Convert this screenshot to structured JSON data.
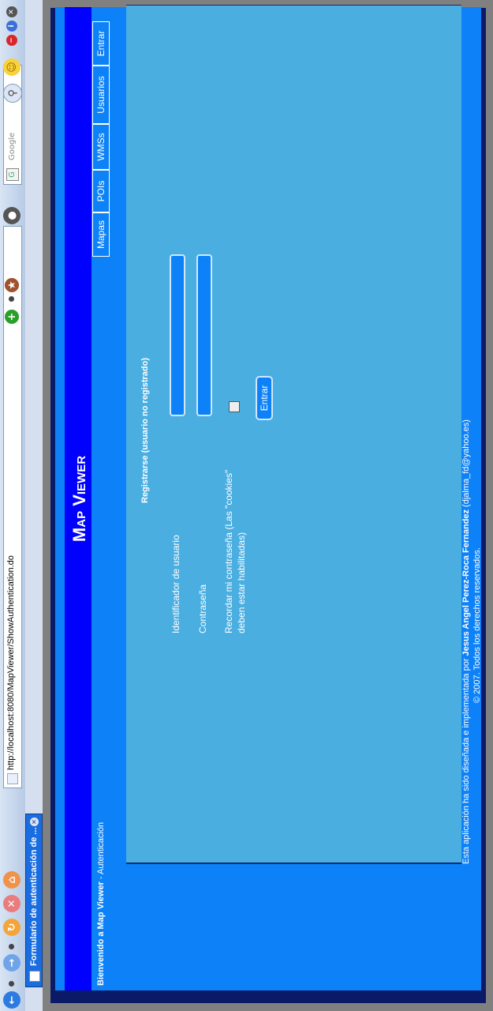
{
  "browser": {
    "url": "http://localhost:8080/MapViewer/ShowAuthentication.do",
    "search_placeholder": "Google",
    "tab_title": "Formulario de autenticación de ..."
  },
  "app": {
    "title": "Map Viewer",
    "breadcrumb_app": "Bienvenido a Map Viewer",
    "breadcrumb_sep": " - ",
    "breadcrumb_page": "Autenticación"
  },
  "nav": {
    "items": [
      {
        "label": "Mapas"
      },
      {
        "label": "POIs"
      },
      {
        "label": "WMSs"
      },
      {
        "label": "Usuarios"
      },
      {
        "label": "Entrar"
      }
    ]
  },
  "form": {
    "heading": "Registrarse (usuario no registrado)",
    "user_label": "Identificador de usuario",
    "user_value": "",
    "password_label": "Contraseña",
    "password_value": "",
    "remember_line1": "Recordar mi contraseña (Las \"cookies\"",
    "remember_line2": "deben estar habilitadas)",
    "remember_checked": false,
    "submit_label": "Entrar"
  },
  "footer": {
    "line1_prefix": "Esta aplicación ha sido diseñada e implementada por ",
    "author": "Jesus Angel Perez-Roca Fernandez",
    "email": " (djalma_fd@yahoo.es)",
    "line2": "© 2007. Todos los derechos reservados."
  },
  "colors": {
    "banner": "#0000ff",
    "frame_blue": "#0d82f8",
    "content_bg": "#4aaee0"
  }
}
